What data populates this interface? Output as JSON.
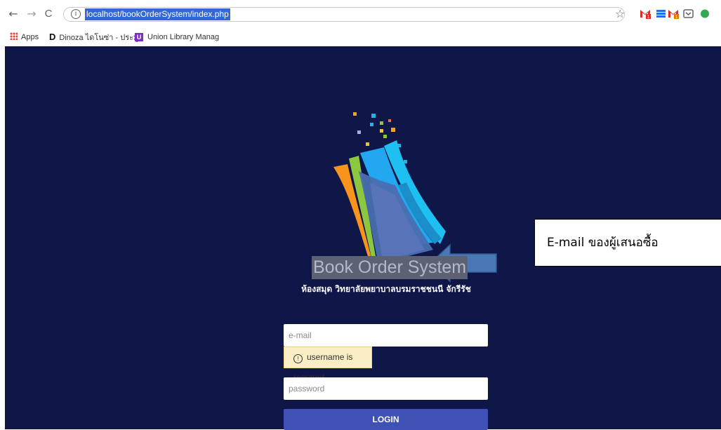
{
  "browser": {
    "back": "←",
    "forward": "→",
    "reload": "C",
    "info_icon": "i",
    "url": "localhost/bookOrderSystem/index.php",
    "star": "☆"
  },
  "bookmarks": {
    "apps": "Apps",
    "dinoza": "Dinoza ไดโนซ่า - ประมู",
    "dinoza_icon": "D",
    "union": "Union Library Manag",
    "union_icon": "U"
  },
  "page": {
    "title": "Book Order System",
    "subtitle": "ห้องสมุด วิทยาลัยพยาบาลบรมราชชนนี จักรีรัช",
    "email_placeholder": "e-mail",
    "tooltip_icon": "!",
    "tooltip_text": "username is required",
    "password_placeholder": "password",
    "login_label": "LOGIN"
  },
  "annotation": {
    "text": "E-mail  ของผู้เสนอซื้อ"
  },
  "colors": {
    "page_bg": "#0f1648",
    "login_button": "#3f51b5",
    "tooltip_bg": "#fbeec4",
    "arrow": "#4a78b4"
  }
}
